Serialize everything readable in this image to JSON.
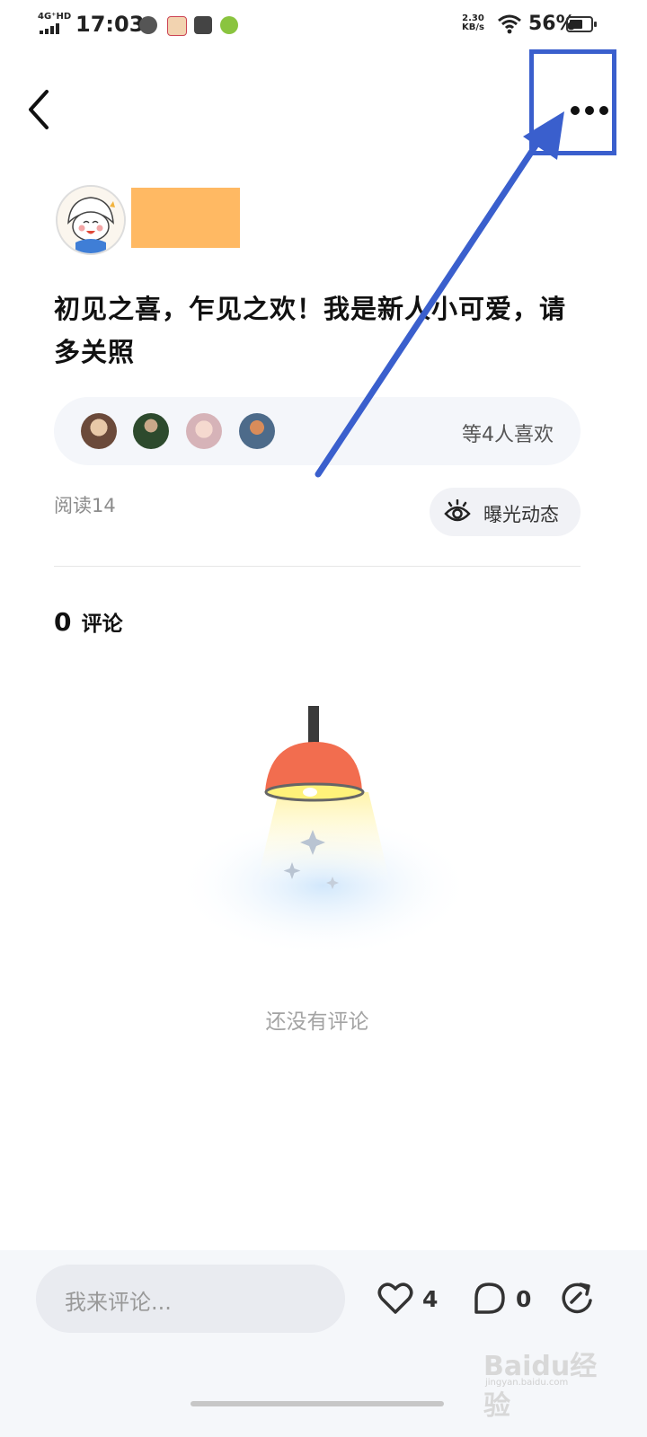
{
  "status_bar": {
    "network": "4G⁺HD",
    "time": "17:03",
    "speed": "2.30",
    "speed_unit": "KB/s",
    "battery": "56%"
  },
  "header": {
    "back_icon": "chevron-left-icon",
    "more_icon": "more-horizontal-icon"
  },
  "post": {
    "text": "初见之喜，乍见之欢！我是新人小可爱，请多关照",
    "likes_text": "等4人喜欢",
    "reads": "阅读14",
    "expose_label": "曝光动态"
  },
  "comments": {
    "count": "0",
    "label": "评论",
    "empty_text": "还没有评论"
  },
  "bottom_bar": {
    "input_placeholder": "我来评论...",
    "like_count": "4",
    "comment_count": "0",
    "like_icon": "heart-icon",
    "comment_icon": "speech-bubble-icon",
    "share_icon": "share-refresh-icon"
  },
  "watermark": {
    "text": "Baidu经验",
    "url": "jingyan.baidu.com"
  },
  "colors": {
    "annotation": "#3a5fcd",
    "username_mask": "#ffb963",
    "lamp_shade": "#f26d4f",
    "panel_bg": "#f4f6fa"
  }
}
